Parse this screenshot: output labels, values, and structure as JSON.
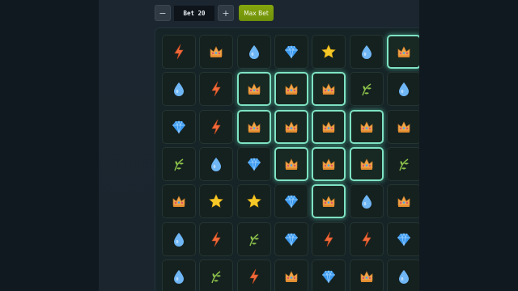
{
  "controls": {
    "minus_label": "−",
    "bet_label": "Bet 20",
    "plus_label": "+",
    "max_bet_label": "Max Bet"
  },
  "grid": {
    "rows": [
      [
        "lightning",
        "crown",
        "drop",
        "diamond",
        "star",
        "drop",
        "crown"
      ],
      [
        "drop",
        "lightning",
        "crown",
        "crown",
        "crown",
        "leaf",
        "drop"
      ],
      [
        "diamond",
        "lightning",
        "crown",
        "crown",
        "crown",
        "crown",
        "crown"
      ],
      [
        "leaf",
        "drop",
        "diamond",
        "crown",
        "crown",
        "crown",
        "leaf"
      ],
      [
        "crown",
        "star",
        "star",
        "diamond",
        "crown",
        "drop",
        "crown"
      ],
      [
        "drop",
        "lightning",
        "leaf",
        "diamond",
        "lightning",
        "lightning",
        "diamond"
      ],
      [
        "drop",
        "leaf",
        "lightning",
        "crown",
        "diamond",
        "crown",
        "drop"
      ]
    ],
    "highlighted": [
      [
        0,
        6
      ],
      [
        1,
        2
      ],
      [
        1,
        3
      ],
      [
        1,
        4
      ],
      [
        2,
        2
      ],
      [
        2,
        3
      ],
      [
        2,
        4
      ],
      [
        2,
        5
      ],
      [
        3,
        3
      ],
      [
        3,
        4
      ],
      [
        3,
        5
      ],
      [
        4,
        4
      ]
    ]
  },
  "colors": {
    "highlight": "#7fe3c3",
    "max_bet": "#7a9a0c",
    "lightning": "#f26a3b",
    "crown": "#f0a64a",
    "drop": "#6fb6f5",
    "diamond": "#3d9bf0",
    "star": "#f7c928",
    "leaf": "#8cc24a"
  }
}
